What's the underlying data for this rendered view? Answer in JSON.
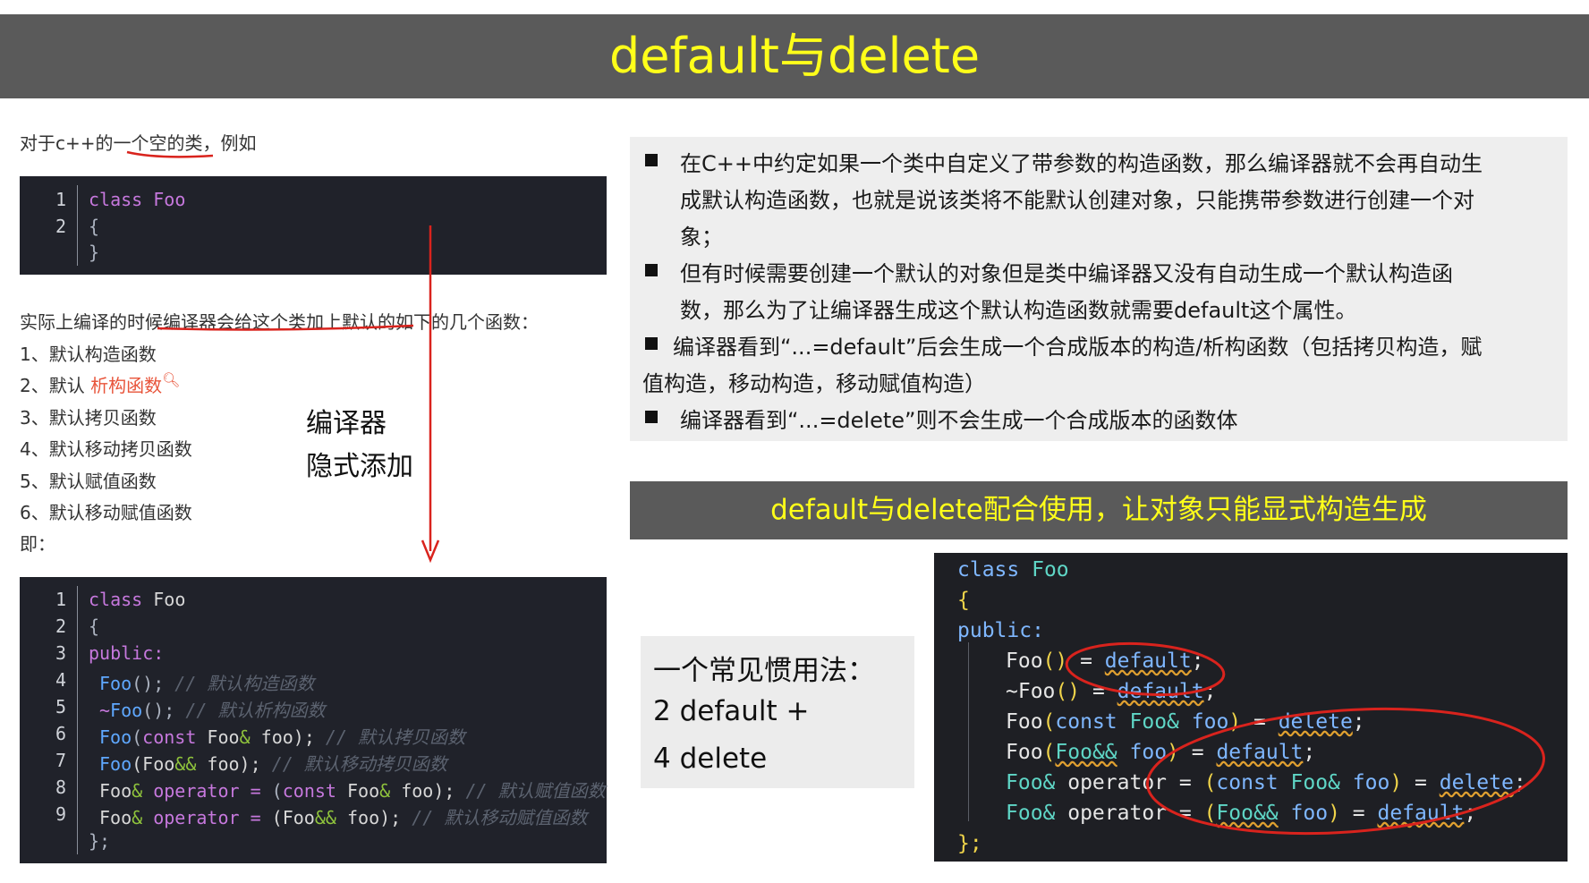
{
  "title": "default与delete",
  "left": {
    "intro_prefix": "对于c++的",
    "intro_highlight": "一个空的类",
    "intro_suffix": "，例如",
    "code1": {
      "lines": [
        {
          "n": "1",
          "text": "class Foo"
        },
        {
          "n": "2",
          "text": "{"
        },
        {
          "n": "",
          "text": "}"
        }
      ]
    },
    "explain": "实际上编译的时候编译器会给这个类加上默认的如下的几个函数：",
    "list": [
      "1、默认构造函数",
      "2、默认 ",
      "3、默认拷贝函数",
      "4、默认移动拷贝函数",
      "5、默认赋值函数",
      "6、默认移动赋值函数"
    ],
    "list2_link": "析构函数",
    "ji": "即：",
    "annotation_line1": "编译器",
    "annotation_line2": "隐式添加",
    "code2": {
      "line_numbers": [
        "1",
        "2",
        "3",
        "4",
        "5",
        "6",
        "7",
        "8",
        "9",
        ""
      ],
      "class_kw": "class",
      "class_name": "Foo",
      "open": "{",
      "public": "public:",
      "l4_fn": "Foo",
      "l4_rest": "();",
      "l4_cm": "// 默认构造函数",
      "l5_tilde": "~",
      "l5_fn": "Foo",
      "l5_rest": "();",
      "l5_cm": "// 默认析构函数",
      "l6_fn": "Foo",
      "l6_rest": "(",
      "l6_const": "const",
      "l6_type": " Foo",
      "l6_amp": "&",
      "l6_tail": " foo);",
      "l6_cm": "// 默认拷贝函数",
      "l7_fn": "Foo",
      "l7_rest": "(Foo",
      "l7_amp": "&&",
      "l7_tail": " foo);",
      "l7_cm": "// 默认移动拷贝函数",
      "l8_fn": "Foo",
      "l8_amp": "&",
      "l8_op": " operator",
      "l8_eq": " =",
      "l8_rest": " (",
      "l8_const": "const",
      "l8_type": " Foo",
      "l8_amp2": "&",
      "l8_tail": " foo);",
      "l8_cm": "// 默认赋值函数",
      "l9_fn": "Foo",
      "l9_amp": "&",
      "l9_op": " operator",
      "l9_eq": " =",
      "l9_rest": " (Foo",
      "l9_amp2": "&&",
      "l9_tail": " foo);",
      "l9_cm": "// 默认移动赋值函数",
      "close": "};"
    }
  },
  "right": {
    "bullets": [
      {
        "lines": [
          "在C++中约定如果一个类中自定义了带参数的构造函数，那么编译器就不会再自动生",
          "成默认构造函数，也就是说该类将不能默认创建对象，只能携带参数进行创建一个对",
          "象；"
        ]
      },
      {
        "lines": [
          "但有时候需要创建一个默认的对象但是类中编译器又没有自动生成一个默认构造函",
          "数，那么为了让编译器生成这个默认构造函数就需要default这个属性。"
        ]
      },
      {
        "lines": [
          "编译器看到“...=default”后会生成一个合成版本的构造/析构函数（包括拷贝构造，赋",
          "值构造，移动构造，移动赋值构造）"
        ]
      },
      {
        "lines": [
          "编译器看到“...=delete”则不会生成一个合成版本的函数体"
        ]
      }
    ],
    "section_title": "default与delete配合使用，让对象只能显式构造生成",
    "idiom": {
      "line1": "一个常见惯用法：",
      "line2": "2 default +",
      "line3": "4 delete"
    },
    "code": {
      "l1_kw": "class",
      "l1_name": " Foo",
      "l2": "{",
      "l3": "public:",
      "l4_fn": "Foo",
      "l4_paren": "()",
      "l4_eq": " = ",
      "l4_val": "default",
      "l4_end": ";",
      "l5_fn": "~Foo",
      "l5_paren": "()",
      "l5_eq": " = ",
      "l5_val": "default",
      "l5_end": ";",
      "l6_fn": "Foo",
      "l6_open": "(",
      "l6_const": "const",
      "l6_type": " Foo&",
      "l6_arg": " foo",
      "l6_close": ")",
      "l6_eq": " = ",
      "l6_val": "delete",
      "l6_end": ";",
      "l7_fn": "Foo",
      "l7_open": "(",
      "l7_type": "Foo&&",
      "l7_arg": " foo",
      "l7_close": ")",
      "l7_eq": " = ",
      "l7_val": "default",
      "l7_end": ";",
      "l8_type": "Foo&",
      "l8_op": " operator =",
      "l8_open": " (",
      "l8_const": "const",
      "l8_type2": " Foo&",
      "l8_arg": " foo",
      "l8_close": ")",
      "l8_eq": " = ",
      "l8_val": "delete",
      "l8_end": ";",
      "l9_type": "Foo&",
      "l9_op": " operator =",
      "l9_open": " (",
      "l9_type2": "Foo&&",
      "l9_arg": " foo",
      "l9_close": ")",
      "l9_eq": " = ",
      "l9_val": "default",
      "l9_end": ";",
      "l10": "};"
    }
  },
  "colors": {
    "header_bg": "#5a5a5a",
    "title_yellow": "#ffff1a",
    "annotation_red": "#d9231d",
    "link_orange": "#e8543a"
  }
}
